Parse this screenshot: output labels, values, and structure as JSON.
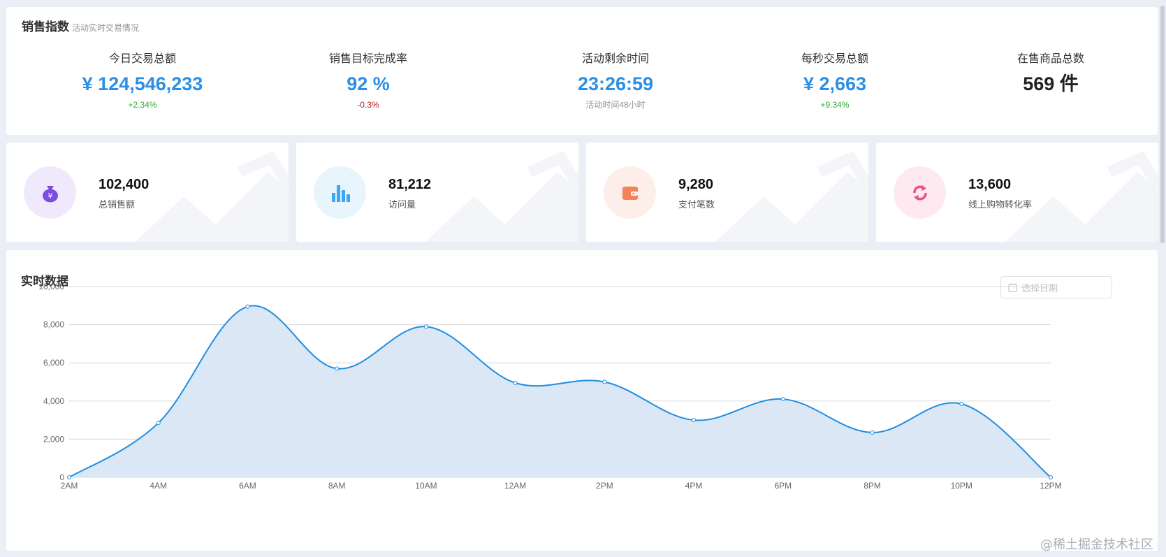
{
  "sales_panel": {
    "title": "销售指数",
    "subtitle": "活动实时交易情况",
    "kpis": [
      {
        "label": "今日交易总额",
        "value": "¥ 124,546,233",
        "note": "+2.34%"
      },
      {
        "label": "销售目标完成率",
        "value": "92 %",
        "note": "-0.3%"
      },
      {
        "label": "活动剩余时间",
        "value": "23:26:59",
        "note": "活动时间48小时"
      },
      {
        "label": "每秒交易总额",
        "value": "¥ 2,663",
        "note": "+9.34%"
      },
      {
        "label": "在售商品总数",
        "value": "569 件",
        "note": ""
      }
    ]
  },
  "cards": [
    {
      "value": "102,400",
      "label": "总销售额",
      "icon": "money-bag-icon",
      "color": "#7a4fe0",
      "bg": "#efe9fb"
    },
    {
      "value": "81,212",
      "label": "访问量",
      "icon": "bar-chart-icon",
      "color": "#3fa7f2",
      "bg": "#e8f5fd"
    },
    {
      "value": "9,280",
      "label": "支付笔数",
      "icon": "wallet-icon",
      "color": "#f2835b",
      "bg": "#fdeee9"
    },
    {
      "value": "13,600",
      "label": "线上购物转化率",
      "icon": "refresh-icon",
      "color": "#ee4f84",
      "bg": "#fde9ef"
    }
  ],
  "realtime": {
    "title": "实时数据",
    "date_placeholder": "选择日期"
  },
  "chart_data": {
    "type": "area",
    "x": [
      "2AM",
      "4AM",
      "6AM",
      "8AM",
      "10AM",
      "12AM",
      "2PM",
      "4PM",
      "6PM",
      "8PM",
      "10PM",
      "12PM"
    ],
    "y": [
      0,
      2850,
      8950,
      5700,
      7900,
      4950,
      5000,
      3000,
      4100,
      2350,
      3850,
      0
    ],
    "yticks": [
      "0",
      "2,000",
      "4,000",
      "6,000",
      "8,000",
      "10,000"
    ],
    "ylim": [
      0,
      10000
    ],
    "grid": true,
    "line_color": "#1f8ee0",
    "fill_color": "#dbe7f4"
  },
  "watermark": "@稀土掘金技术社区"
}
